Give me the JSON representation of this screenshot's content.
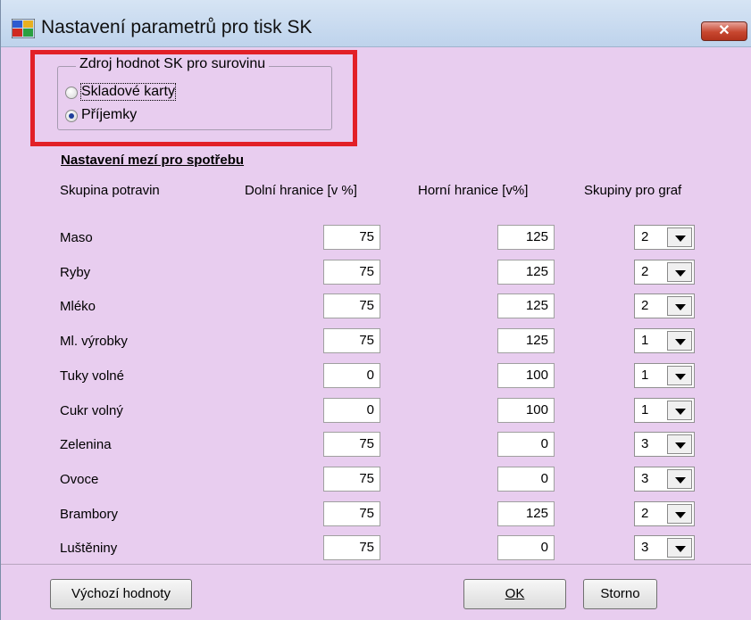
{
  "window": {
    "title": "Nastavení parametrů pro tisk SK",
    "close_label": "✕"
  },
  "source_group": {
    "legend": "Zdroj hodnot SK pro surovinu",
    "options": [
      {
        "label": "Skladové karty",
        "selected": false
      },
      {
        "label": "Příjemky",
        "selected": true
      }
    ]
  },
  "limits": {
    "section_title": "Nastavení mezí pro spotřebu",
    "headers": {
      "group": "Skupina potravin",
      "lower": "Dolní hranice [v %]",
      "upper": "Horní hranice [v%]",
      "chart_group": "Skupiny pro graf"
    },
    "rows": [
      {
        "name": "Maso",
        "lower": "75",
        "upper": "125",
        "chart_group": "2"
      },
      {
        "name": "Ryby",
        "lower": "75",
        "upper": "125",
        "chart_group": "2"
      },
      {
        "name": "Mléko",
        "lower": "75",
        "upper": "125",
        "chart_group": "2"
      },
      {
        "name": "Ml. výrobky",
        "lower": "75",
        "upper": "125",
        "chart_group": "1"
      },
      {
        "name": "Tuky volné",
        "lower": "0",
        "upper": "100",
        "chart_group": "1"
      },
      {
        "name": "Cukr volný",
        "lower": "0",
        "upper": "100",
        "chart_group": "1"
      },
      {
        "name": "Zelenina",
        "lower": "75",
        "upper": "0",
        "chart_group": "3"
      },
      {
        "name": "Ovoce",
        "lower": "75",
        "upper": "0",
        "chart_group": "3"
      },
      {
        "name": "Brambory",
        "lower": "75",
        "upper": "125",
        "chart_group": "2"
      },
      {
        "name": "Luštěniny",
        "lower": "75",
        "upper": "0",
        "chart_group": "3"
      }
    ]
  },
  "buttons": {
    "defaults": "Výchozí hodnoty",
    "ok": "OK",
    "cancel": "Storno"
  },
  "colors": {
    "background": "#e8cdef",
    "highlight_border": "#e22027"
  }
}
